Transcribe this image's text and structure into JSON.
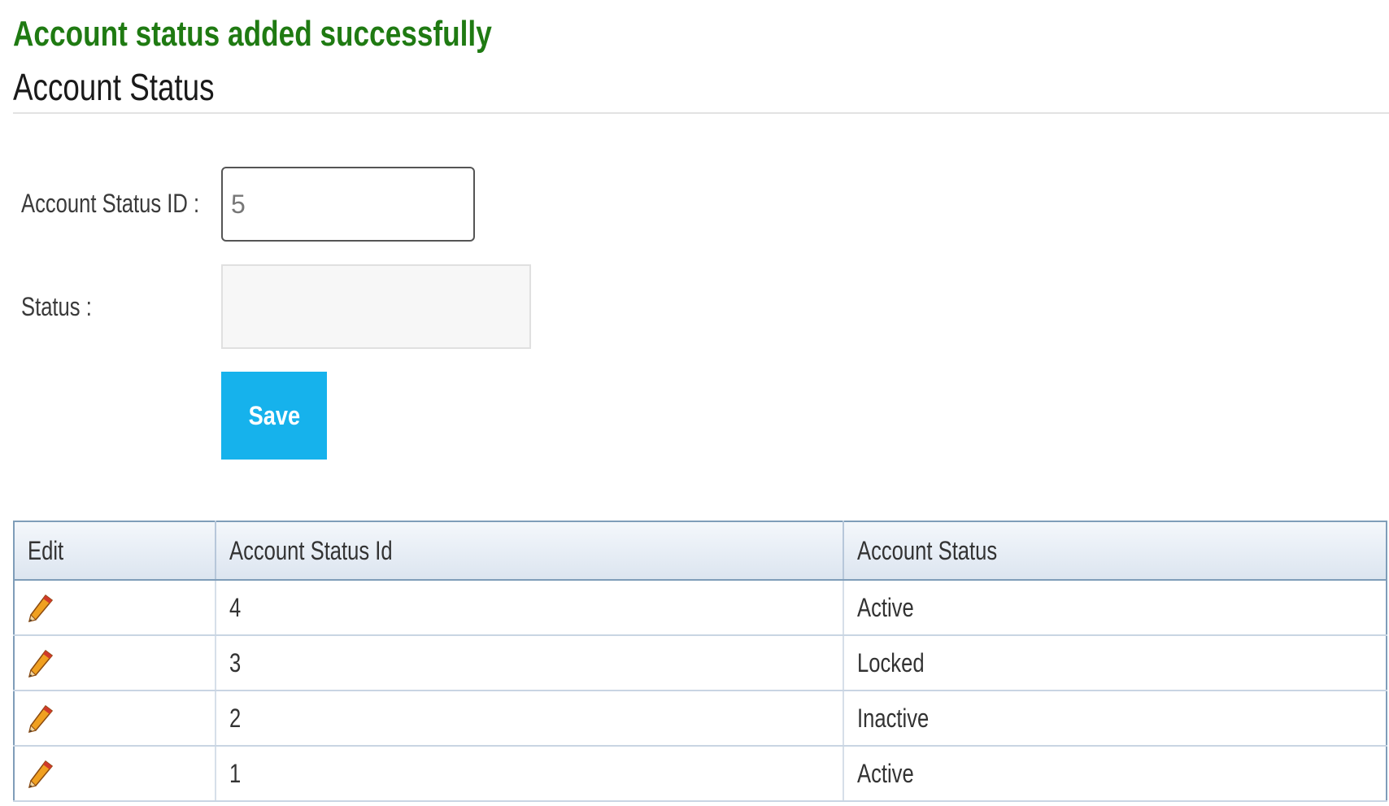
{
  "message": {
    "success": "Account status added successfully"
  },
  "page": {
    "title": "Account Status"
  },
  "form": {
    "id_label": "Account Status ID :",
    "id_value": "5",
    "status_label": "Status :",
    "status_value": "",
    "save_label": "Save"
  },
  "table": {
    "headers": [
      "Edit",
      "Account Status Id",
      "Account Status"
    ],
    "rows": [
      {
        "id": "4",
        "status": "Active"
      },
      {
        "id": "3",
        "status": "Locked"
      },
      {
        "id": "2",
        "status": "Inactive"
      },
      {
        "id": "1",
        "status": "Active"
      }
    ],
    "edit_icon": "pencil-icon"
  },
  "colors": {
    "success": "#1f7a12",
    "button": "#16b2ec",
    "table_border": "#7f9db9"
  }
}
